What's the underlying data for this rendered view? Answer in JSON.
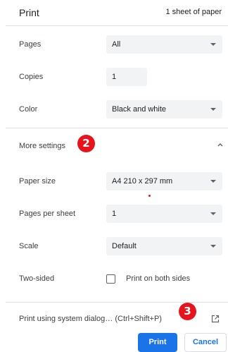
{
  "header": {
    "title": "Print",
    "sheet_count": "1 sheet of paper"
  },
  "settings": {
    "pages": {
      "label": "Pages",
      "value": "All"
    },
    "copies": {
      "label": "Copies",
      "value": "1"
    },
    "color": {
      "label": "Color",
      "value": "Black and white"
    },
    "more_settings": {
      "label": "More settings"
    },
    "paper_size": {
      "label": "Paper size",
      "value": "A4 210 x 297 mm"
    },
    "pages_per_sheet": {
      "label": "Pages per sheet",
      "value": "1"
    },
    "scale": {
      "label": "Scale",
      "value": "Default"
    },
    "two_sided": {
      "label": "Two-sided",
      "option": "Print on both sides",
      "checked": false
    }
  },
  "system_dialog": {
    "label": "Print using system dialog… (Ctrl+Shift+P)"
  },
  "annotations": {
    "badge_2": "2",
    "badge_3": "3",
    "badge_color": "#e8141b"
  },
  "buttons": {
    "print": "Print",
    "cancel": "Cancel"
  },
  "colors": {
    "accent": "#1a73e8",
    "field_bg": "#f1f3f4",
    "divider": "#e0e0e0"
  }
}
